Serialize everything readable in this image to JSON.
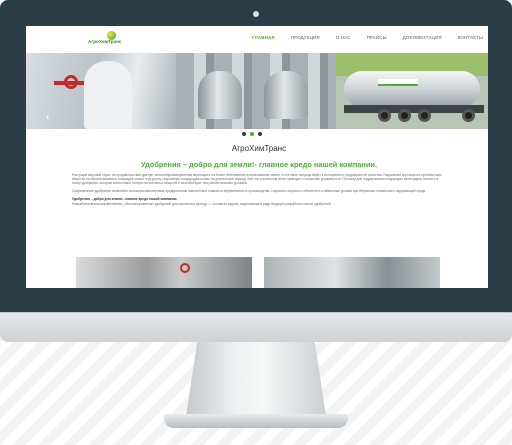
{
  "site": {
    "logo_line1": "АгроХимТранс",
    "logo_line2": "ХимТранс"
  },
  "nav": {
    "items": [
      {
        "label": "ГЛАВНАЯ",
        "active": true
      },
      {
        "label": "ПРОДУКЦИЯ",
        "active": false
      },
      {
        "label": "О НАС",
        "active": false
      },
      {
        "label": "ПРАЙСЫ",
        "active": false
      },
      {
        "label": "ДОКУМЕНТАЦИЯ",
        "active": false
      },
      {
        "label": "КОНТАКТЫ",
        "active": false
      }
    ]
  },
  "slider": {
    "prev_icon": "‹",
    "next_icon": "›",
    "dots_count": 3,
    "active_dot": 1
  },
  "content": {
    "title": "АгроХимТранс",
    "slogan": "Удобрения – добро для земли!- главное кредо нашей компании.",
    "para1": "Растущий мировой спрос на продовольствие диктует сельхозпроизводителям переходить на более интенсивное использование земли, что в свою очередь ведет к истощению и ухудшению её качества. Нарушение круговорота органических веществ на обрабатываемых площадях ставит под угрозу сохранение плодородия почвы на длительный период. Всё это в конечном итоге приводит к снижению урожайности. Поэтому для поддержания плодородия необходимо вносить в почву удобрения, которые восполняют потери питательных веществ и способствуют получению высоких урожаев.",
    "para2": "Современные удобрения позволяют сельскохозяйственным предприятиям значительно повысить эффективность производства, сократить затраты и обеспечить стабильные урожаи при бережном отношении к окружающей среде.",
    "para3_bold": "Удобрения – добро для земли!- главное кредо нашей компании.",
    "para3": "Разработка высокоэффективных, сбалансированных удобрений для различных культур — основная задача, выделяемая в ряде ведущих разработок наших удобрений."
  },
  "colors": {
    "accent": "#4caf32",
    "bezel": "#2b3d47"
  }
}
